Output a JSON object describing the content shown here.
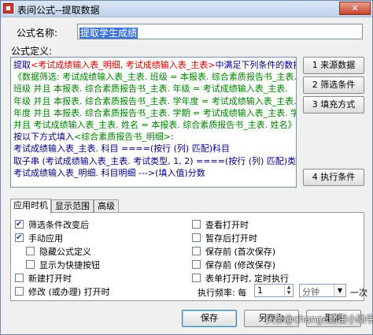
{
  "window": {
    "title": "表间公式--提取数据",
    "close_glyph": "✕"
  },
  "form": {
    "name_label": "公式名称:",
    "name_value": "提取学生成绩",
    "definition_label": "公式定义:"
  },
  "formula_lines": [
    [
      {
        "t": "提取",
        "c": "b"
      },
      {
        "t": "<考试成绩输入表_明细, 考试成绩输入表_主表>",
        "c": "r"
      },
      {
        "t": "中满足下列条件的数据:",
        "c": "b"
      }
    ],
    [
      {
        "t": "   《数据筛选: 考试成绩输入表_主表. 班级 = 本报表. 综合素质报告书_主表.",
        "c": "g"
      }
    ],
    [
      {
        "t": "班级          并且 本报表. 综合素质报告书_主表. 年级 = 考试成绩输入表_主表.",
        "c": "g"
      }
    ],
    [
      {
        "t": "年级          并且 本报表. 综合素质报告书_主表. 学年度 = 考试成绩输入表_主表. 学",
        "c": "g"
      }
    ],
    [
      {
        "t": "年度       并且 本报表. 综合素质报告书_主表. 学期 = 考试成绩输入表_主表. 学期",
        "c": "g"
      }
    ],
    [
      {
        "t": "      并且 考试成绩输入表_主表. 姓名 = 本报表. 综合素质报告书_主表. 姓名》",
        "c": "g"
      }
    ],
    [
      {
        "t": "按以下方式填入",
        "c": "b"
      },
      {
        "t": "<综合素质报告书_明细>",
        "c": "g"
      },
      {
        "t": ":",
        "c": "b"
      }
    ],
    [
      {
        "t": "考试成绩输入表_主表. 科目    ====(按行 (列) 匹配)科目",
        "c": "b"
      }
    ],
    [
      {
        "t": "取子串 (考试成绩输入表_主表. 考试类型, 1, 2)     ====(按行 (列) 匹配)类型",
        "c": "b"
      }
    ],
    [
      {
        "t": "考试成绩输入表_明细. 科目明细   --->(填入值)分数",
        "c": "b"
      }
    ]
  ],
  "side_buttons": [
    "1  来源数据",
    "2  筛选条件",
    "3  填充方式",
    "4  执行条件"
  ],
  "tabs": [
    "应用时机",
    "显示范围",
    "高级"
  ],
  "options_left": [
    {
      "label": "筛选条件改变后",
      "checked": true
    },
    {
      "label": "手动应用",
      "checked": true
    },
    {
      "label": "隐藏公式定义",
      "checked": false
    },
    {
      "label": "显示为快捷按钮",
      "checked": false
    },
    {
      "label": "新建打开时",
      "checked": false
    },
    {
      "label": "修改 (或办理) 打开时",
      "checked": false
    }
  ],
  "options_right": [
    {
      "label": "查看打开时",
      "checked": false
    },
    {
      "label": "暂存后打开时",
      "checked": false
    },
    {
      "label": "保存前 (首次保存)",
      "checked": false
    },
    {
      "label": "保存前 (修改保存)",
      "checked": false
    },
    {
      "label": "表单打开时, 定时执行",
      "checked": false
    }
  ],
  "frequency": {
    "label": "执行频率: 每",
    "value": "1",
    "unit": "分钟",
    "suffix": "一次"
  },
  "footer": {
    "save": "保存",
    "save_as": "另存为",
    "cancel": "取消"
  },
  "watermark": "头条@change勤雷小助手"
}
